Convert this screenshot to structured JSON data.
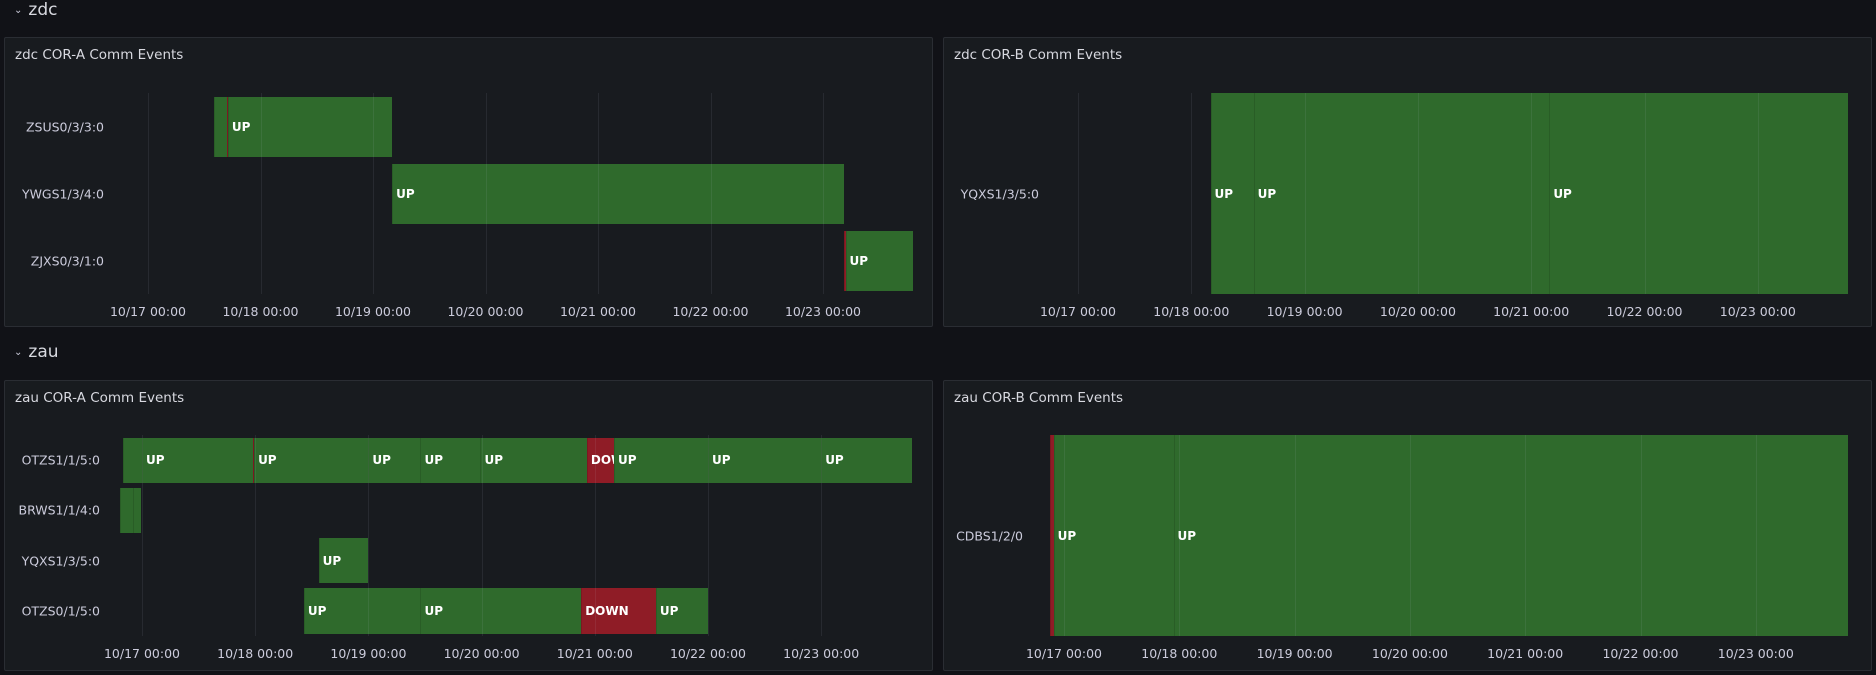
{
  "sections": [
    {
      "title": "zdc",
      "chevron_icon": "chevron-down-icon"
    },
    {
      "title": "zau",
      "chevron_icon": "chevron-down-icon"
    }
  ],
  "states": {
    "UP": "#2f6a2c",
    "DOWN": "#8f1c26"
  },
  "chart_data": [
    {
      "type": "state-timeline",
      "title": "zdc COR-A Comm Events",
      "x_unit": "days since 10/17 00:00",
      "x_ticks": [
        "10/17 00:00",
        "10/18 00:00",
        "10/19 00:00",
        "10/20 00:00",
        "10/21 00:00",
        "10/22 00:00",
        "10/23 00:00"
      ],
      "rows": [
        {
          "name": "ZSUS0/3/3:0",
          "segments": [
            {
              "start": 0.59,
              "end": 0.7,
              "state": "UP"
            },
            {
              "start": 0.7,
              "end": 0.71,
              "state": "DOWN"
            },
            {
              "start": 0.71,
              "end": 2.17,
              "state": "UP"
            }
          ]
        },
        {
          "name": "YWGS1/3/4:0",
          "segments": [
            {
              "start": 2.17,
              "end": 6.19,
              "state": "UP"
            }
          ]
        },
        {
          "name": "ZJXS0/3/1:0",
          "segments": [
            {
              "start": 6.19,
              "end": 6.2,
              "state": "DOWN"
            },
            {
              "start": 6.2,
              "end": 6.8,
              "state": "UP"
            }
          ]
        }
      ]
    },
    {
      "type": "state-timeline",
      "title": "zdc COR-B Comm Events",
      "x_unit": "days since 10/17 00:00",
      "x_ticks": [
        "10/17 00:00",
        "10/18 00:00",
        "10/19 00:00",
        "10/20 00:00",
        "10/21 00:00",
        "10/22 00:00",
        "10/23 00:00"
      ],
      "rows": [
        {
          "name": "YQXS1/3/5:0",
          "segments": [
            {
              "start": 1.17,
              "end": 1.55,
              "state": "UP"
            },
            {
              "start": 1.55,
              "end": 4.16,
              "state": "UP"
            },
            {
              "start": 4.16,
              "end": 6.8,
              "state": "UP"
            }
          ]
        }
      ]
    },
    {
      "type": "state-timeline",
      "title": "zau COR-A Comm Events",
      "x_unit": "days since 10/17 00:00",
      "x_ticks": [
        "10/17 00:00",
        "10/18 00:00",
        "10/19 00:00",
        "10/20 00:00",
        "10/21 00:00",
        "10/22 00:00",
        "10/23 00:00"
      ],
      "rows": [
        {
          "name": "OTZS1/1/5:0",
          "segments": [
            {
              "start": -0.17,
              "end": 0.0,
              "state": "UP"
            },
            {
              "start": 0.0,
              "end": 0.98,
              "state": "UP"
            },
            {
              "start": 0.98,
              "end": 0.99,
              "state": "DOWN"
            },
            {
              "start": 0.99,
              "end": 2.0,
              "state": "UP"
            },
            {
              "start": 2.0,
              "end": 2.46,
              "state": "UP"
            },
            {
              "start": 2.46,
              "end": 2.99,
              "state": "UP"
            },
            {
              "start": 2.99,
              "end": 3.93,
              "state": "UP"
            },
            {
              "start": 3.93,
              "end": 4.17,
              "state": "DOWN"
            },
            {
              "start": 4.17,
              "end": 5.0,
              "state": "UP"
            },
            {
              "start": 5.0,
              "end": 6.0,
              "state": "UP"
            },
            {
              "start": 6.0,
              "end": 6.8,
              "state": "UP"
            }
          ]
        },
        {
          "name": "BRWS1/1/4:0",
          "segments": [
            {
              "start": -0.19,
              "end": -0.08,
              "state": "UP"
            },
            {
              "start": -0.08,
              "end": -0.01,
              "state": "UP"
            }
          ]
        },
        {
          "name": "YQXS1/3/5:0",
          "segments": [
            {
              "start": 1.56,
              "end": 2.0,
              "state": "UP"
            }
          ]
        },
        {
          "name": "OTZS0/1/5:0",
          "segments": [
            {
              "start": 1.43,
              "end": 2.46,
              "state": "UP"
            },
            {
              "start": 2.46,
              "end": 3.88,
              "state": "UP"
            },
            {
              "start": 3.88,
              "end": 4.54,
              "state": "DOWN"
            },
            {
              "start": 4.54,
              "end": 5.0,
              "state": "UP"
            }
          ]
        }
      ]
    },
    {
      "type": "state-timeline",
      "title": "zau COR-B Comm Events",
      "x_unit": "days since 10/17 00:00",
      "x_ticks": [
        "10/17 00:00",
        "10/18 00:00",
        "10/19 00:00",
        "10/20 00:00",
        "10/21 00:00",
        "10/22 00:00",
        "10/23 00:00"
      ],
      "rows": [
        {
          "name": "CDBS1/2/0",
          "segments": [
            {
              "start": -0.12,
              "end": -0.09,
              "state": "DOWN"
            },
            {
              "start": -0.09,
              "end": 0.95,
              "state": "UP"
            },
            {
              "start": 0.95,
              "end": 6.8,
              "state": "UP"
            }
          ]
        }
      ]
    }
  ]
}
